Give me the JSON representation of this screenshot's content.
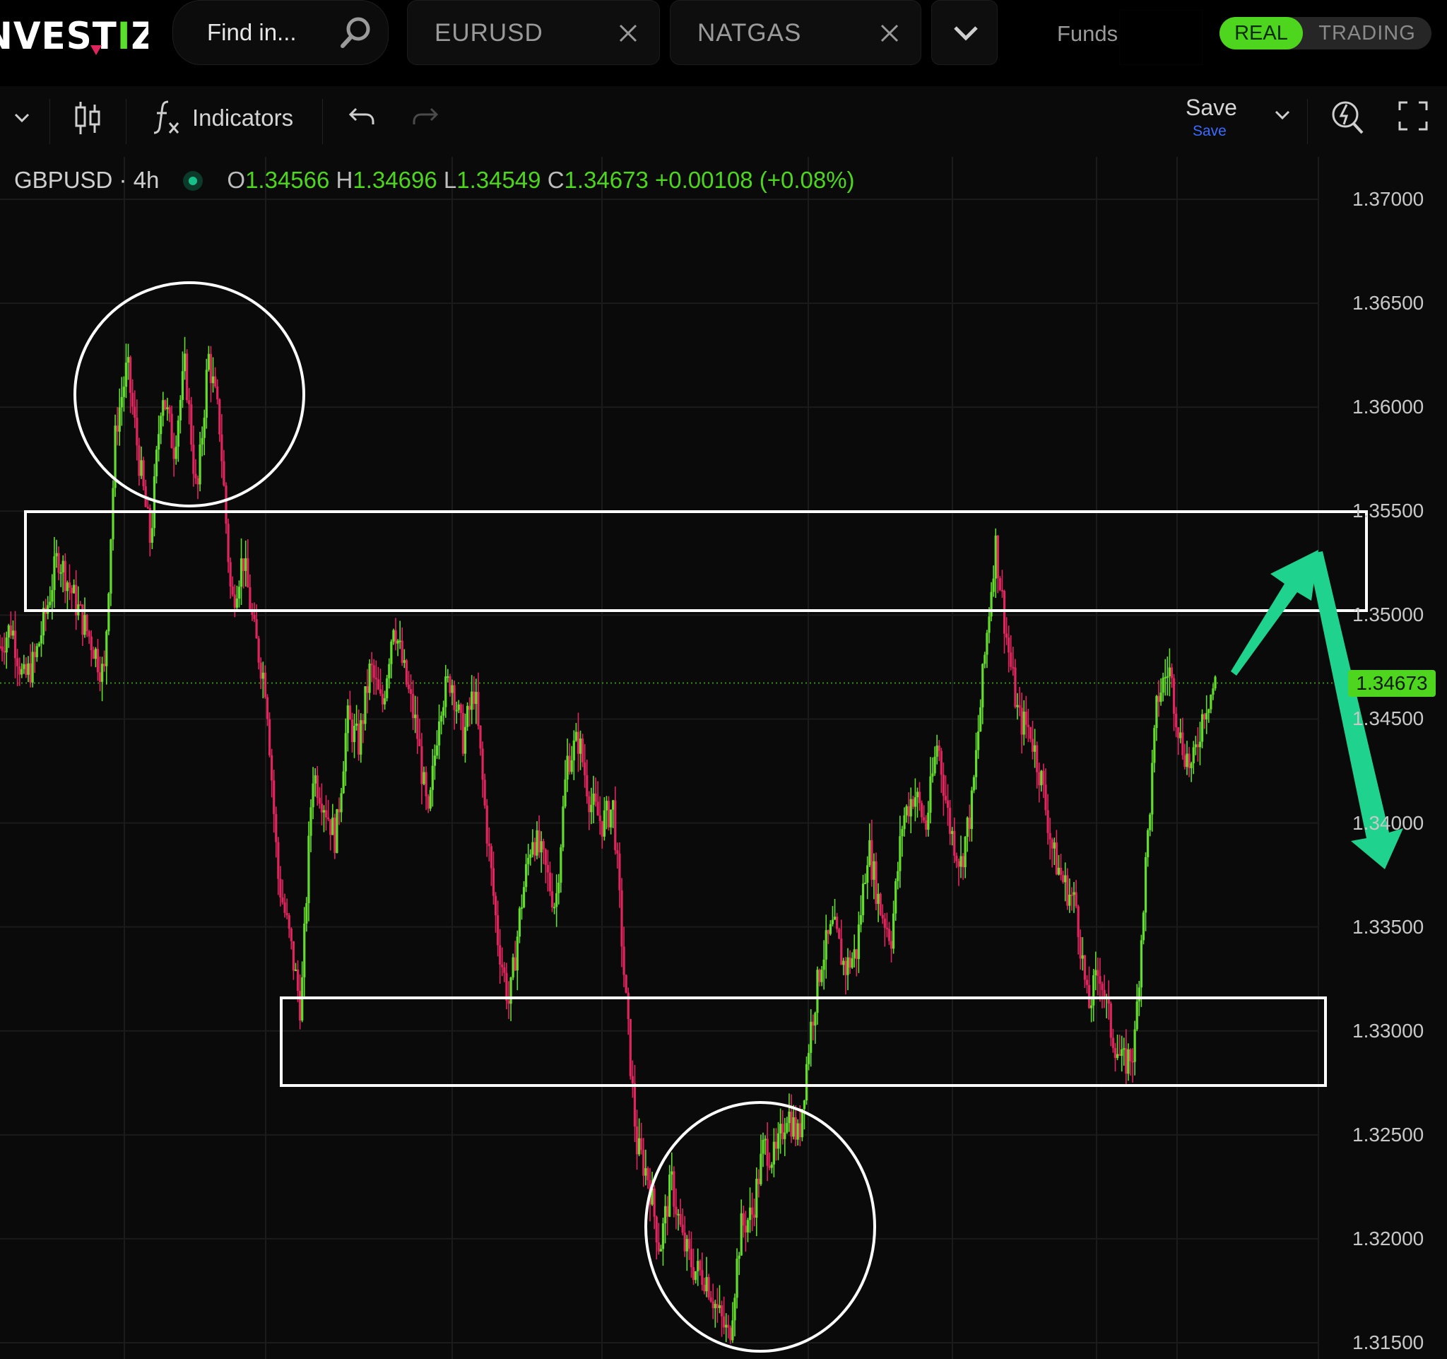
{
  "header": {
    "logo": {
      "prefix": "NVEST",
      "accent": "I",
      "suffix": "ZO"
    },
    "search": {
      "placeholder": "Find in..."
    },
    "tabs": [
      {
        "label": "EURUSD"
      },
      {
        "label": "NATGAS"
      }
    ],
    "funds_label": "Funds:",
    "mode": {
      "real": "REAL",
      "trading": "TRADING"
    }
  },
  "toolbar": {
    "indicators_label": "Indicators",
    "save_label": "Save",
    "save_sublabel": "Save"
  },
  "chart": {
    "legend": {
      "symbol": "GBPUSD · 4h",
      "open_key": "O",
      "open": "1.34566",
      "high_key": "H",
      "high": "1.34696",
      "low_key": "L",
      "low": "1.34549",
      "close_key": "C",
      "close": "1.34673",
      "change": "+0.00108 (+0.08%)"
    },
    "current_price": "1.34673"
  },
  "chart_data": {
    "type": "candlestick",
    "symbol": "GBPUSD",
    "timeframe": "4h",
    "y_ticks": [
      "1.37000",
      "1.36500",
      "1.36000",
      "1.35500",
      "1.35000",
      "1.34500",
      "1.34000",
      "1.33500",
      "1.33000",
      "1.32500",
      "1.32000",
      "1.31500"
    ],
    "ylim": [
      1.3145,
      1.3725
    ],
    "last_close": 1.34673,
    "price_path": [
      1.3485,
      1.3495,
      1.3468,
      1.3478,
      1.3502,
      1.3529,
      1.3514,
      1.3499,
      1.3486,
      1.347,
      1.359,
      1.362,
      1.3575,
      1.3535,
      1.361,
      1.358,
      1.362,
      1.3555,
      1.3625,
      1.359,
      1.3505,
      1.3528,
      1.349,
      1.3465,
      1.3375,
      1.3345,
      1.331,
      1.3425,
      1.341,
      1.3392,
      1.345,
      1.3438,
      1.3475,
      1.3455,
      1.3498,
      1.347,
      1.3445,
      1.34,
      1.3458,
      1.347,
      1.344,
      1.3465,
      1.34,
      1.3345,
      1.3312,
      1.336,
      1.3395,
      1.338,
      1.336,
      1.343,
      1.344,
      1.341,
      1.34,
      1.3408,
      1.332,
      1.3245,
      1.323,
      1.3195,
      1.3228,
      1.3198,
      1.3185,
      1.3182,
      1.3165,
      1.3152,
      1.3205,
      1.3212,
      1.3245,
      1.3238,
      1.3262,
      1.3248,
      1.33,
      1.3335,
      1.335,
      1.333,
      1.3338,
      1.339,
      1.336,
      1.3345,
      1.3402,
      1.3415,
      1.3398,
      1.344,
      1.34,
      1.338,
      1.341,
      1.3475,
      1.3535,
      1.3488,
      1.345,
      1.3445,
      1.342,
      1.3385,
      1.337,
      1.336,
      1.331,
      1.333,
      1.33,
      1.3283,
      1.3291,
      1.338,
      1.346,
      1.3475,
      1.344,
      1.3425,
      1.3455,
      1.3467
    ]
  },
  "colors": {
    "bull": "#64dd2a",
    "bear": "#e0245e",
    "accent": "#4ed61e",
    "annotation_arrow": "#1fd38e",
    "annotation_outline": "#ffffff",
    "background": "#0a0a0a"
  },
  "icons": {
    "search": "search-icon",
    "close": "close-icon",
    "chevron": "chevron-down-icon",
    "candles": "candlestick-icon",
    "fx": "fx-icon",
    "undo": "undo-icon",
    "redo": "redo-icon",
    "quick_search": "quick-search-icon",
    "fullscreen": "fullscreen-icon"
  }
}
